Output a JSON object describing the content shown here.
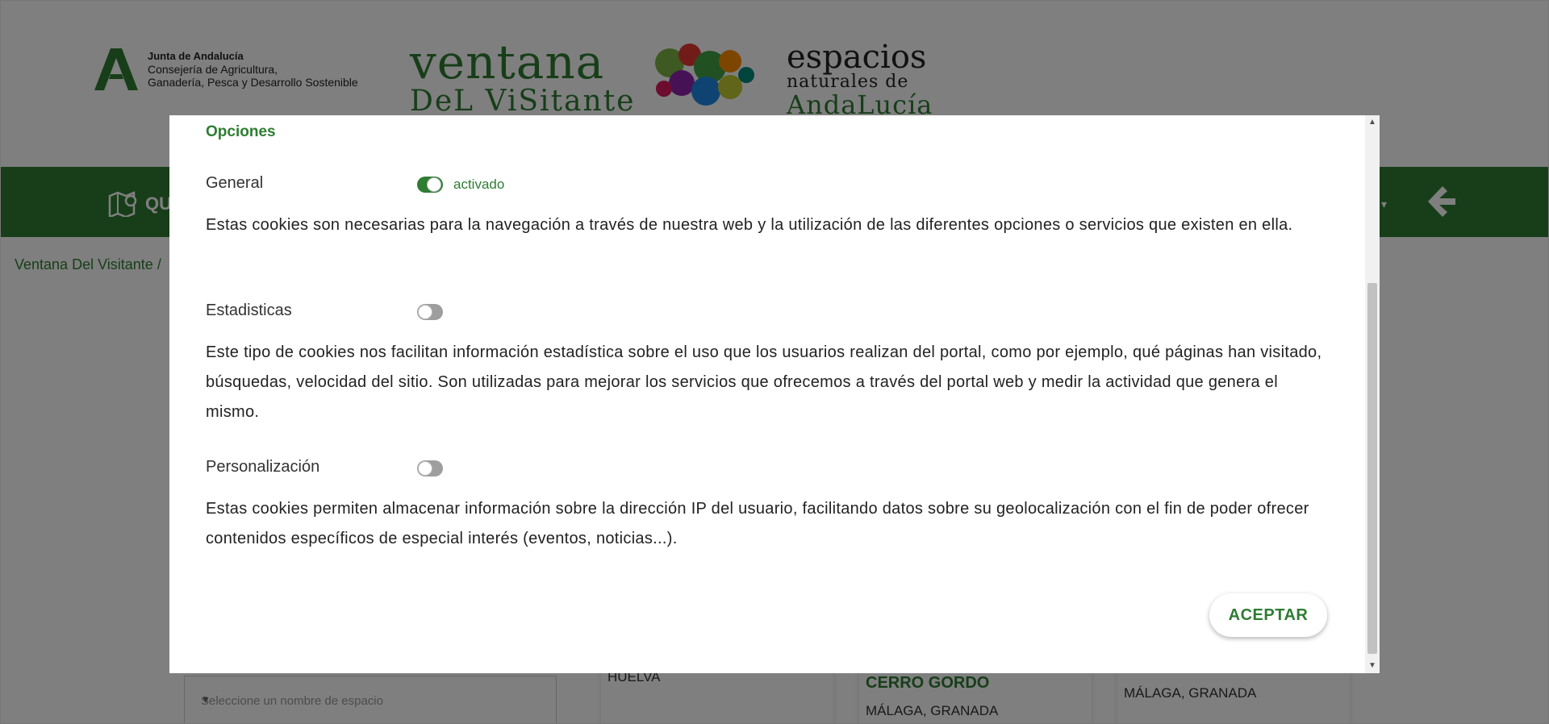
{
  "header": {
    "junta_title": "Junta de Andalucía",
    "junta_line2": "Consejería de Agricultura,",
    "junta_line3": "Ganadería, Pesca y Desarrollo Sostenible",
    "vv_line1": "ventana",
    "vv_line2": "DeL ViSitante",
    "en_line1": "espacios",
    "en_line2": "naturales de",
    "en_line3": "AndaLucía"
  },
  "navbar": {
    "map_label": "QU",
    "map_icon": "map-pin-icon",
    "back_icon": "arrow-left-icon",
    "caret": "▾"
  },
  "breadcrumb": {
    "home": "Ventana Del Visitante",
    "separator": "/"
  },
  "background": {
    "select_placeholder": "Seleccione un nombre de espacio",
    "card1_text": "HUELVA",
    "card2_title": "CERRO GORDO",
    "card2_text": "MÁLAGA, GRANADA",
    "card3_text": "MÁLAGA, GRANADA"
  },
  "modal": {
    "section_title": "Opciones",
    "options": [
      {
        "label": "General",
        "enabled": true,
        "state_text": "activado",
        "description": "Estas cookies son necesarias para la navegación a través de nuestra web y la utilización de las diferentes opciones o servicios que existen en ella."
      },
      {
        "label": "Estadisticas",
        "enabled": false,
        "description": "Este tipo de cookies nos facilitan información estadística sobre el uso que los usuarios realizan del portal, como por ejemplo, qué páginas han visitado, búsquedas, velocidad del sitio. Son utilizadas para mejorar los servicios que ofrecemos a través del portal web y medir la actividad que genera el mismo."
      },
      {
        "label": "Personalización",
        "enabled": false,
        "description": "Estas cookies permiten almacenar información sobre la dirección IP del usuario, facilitando datos sobre su geolocalización con el fin de poder ofrecer contenidos específicos de especial interés (eventos, noticias...)."
      }
    ],
    "accept_label": "ACEPTAR"
  },
  "colors": {
    "brand_green": "#2e7d32",
    "overlay": "rgba(0,0,0,0.5)"
  }
}
